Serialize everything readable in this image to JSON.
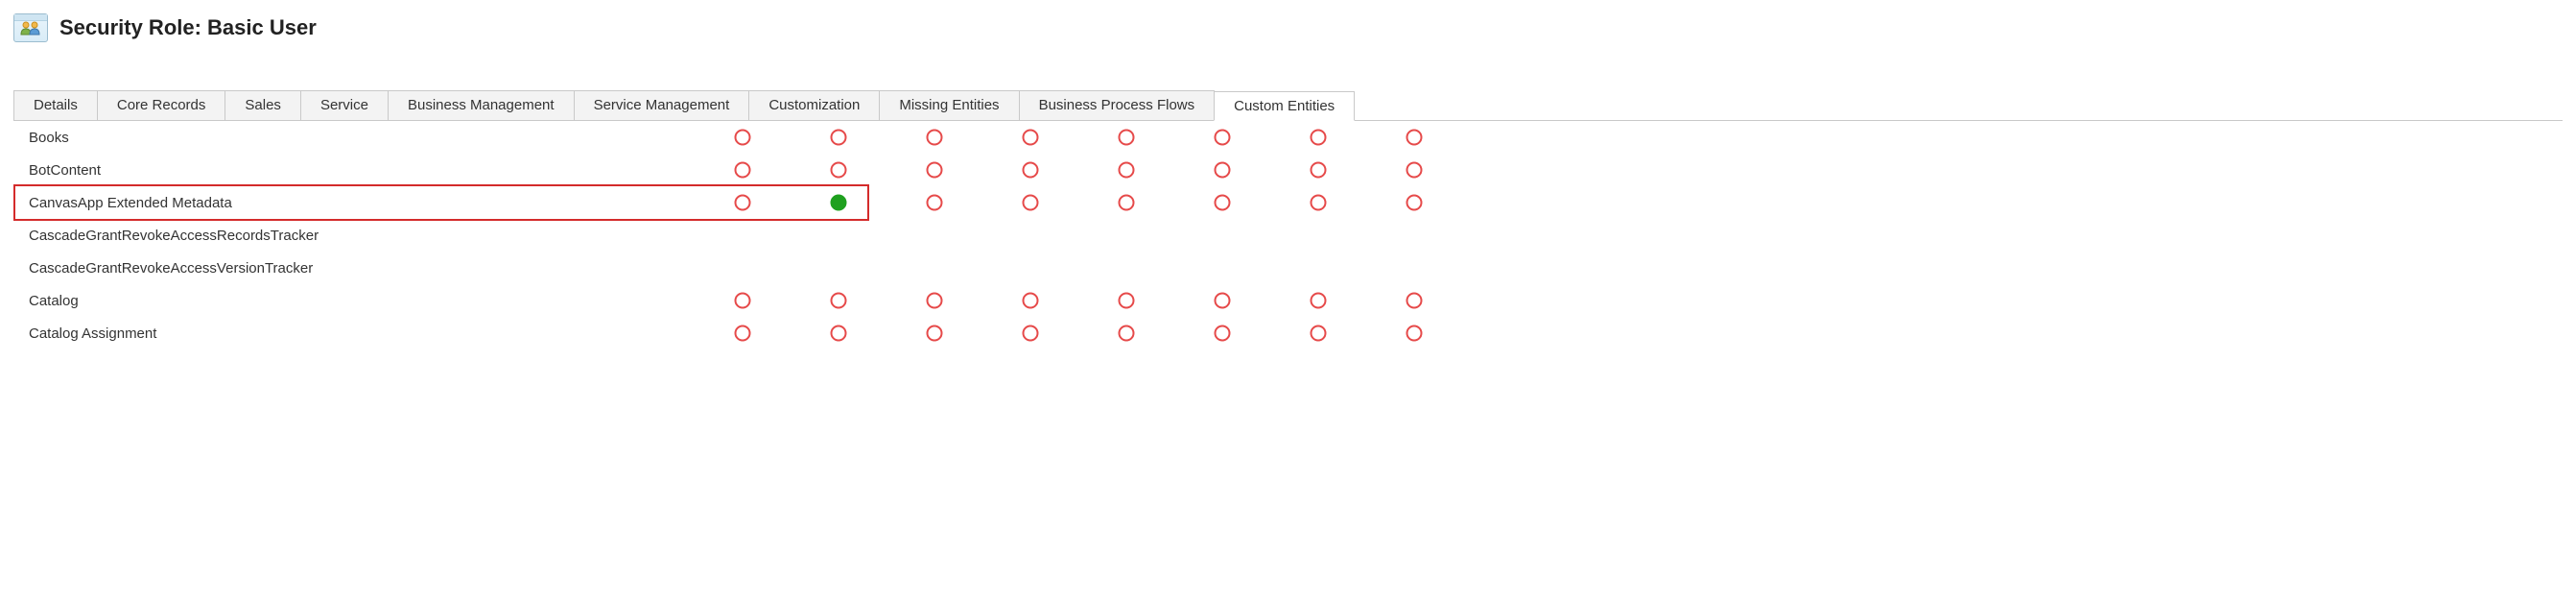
{
  "header": {
    "title": "Security Role: Basic User"
  },
  "tabs": [
    {
      "label": "Details",
      "active": false
    },
    {
      "label": "Core Records",
      "active": false
    },
    {
      "label": "Sales",
      "active": false
    },
    {
      "label": "Service",
      "active": false
    },
    {
      "label": "Business Management",
      "active": false
    },
    {
      "label": "Service Management",
      "active": false
    },
    {
      "label": "Customization",
      "active": false
    },
    {
      "label": "Missing Entities",
      "active": false
    },
    {
      "label": "Business Process Flows",
      "active": false
    },
    {
      "label": "Custom Entities",
      "active": true
    }
  ],
  "privilege_states": {
    "none": {
      "fill": "none",
      "stroke": "#e64a4a"
    },
    "full": {
      "fill": "#1fa01f",
      "stroke": "#1fa01f"
    }
  },
  "rows": [
    {
      "name": "Books",
      "highlighted": false,
      "partial_group": false,
      "privs": [
        "none",
        "none",
        "none",
        "none",
        "none",
        "none",
        "none",
        "none"
      ]
    },
    {
      "name": "BotContent",
      "highlighted": false,
      "partial_group": false,
      "privs": [
        "none",
        "none",
        "none",
        "none",
        "none",
        "none",
        "none",
        "none"
      ]
    },
    {
      "name": "CanvasApp Extended Metadata",
      "highlighted": true,
      "partial_group": false,
      "privs": [
        "none",
        "full",
        "none",
        "none",
        "none",
        "none",
        "none",
        "none"
      ]
    },
    {
      "name": "CascadeGrantRevokeAccessRecordsTracker",
      "highlighted": false,
      "partial_group": false,
      "privs": []
    },
    {
      "name": "CascadeGrantRevokeAccessVersionTracker",
      "highlighted": false,
      "partial_group": false,
      "privs": []
    },
    {
      "name": "Catalog",
      "highlighted": false,
      "partial_group": false,
      "privs": [
        "none",
        "none",
        "none",
        "none",
        "none",
        "none",
        "none",
        "none"
      ]
    },
    {
      "name": "Catalog Assignment",
      "highlighted": false,
      "partial_group": false,
      "privs": [
        "none",
        "none",
        "none",
        "none",
        "none",
        "none",
        "none",
        "none"
      ]
    }
  ]
}
